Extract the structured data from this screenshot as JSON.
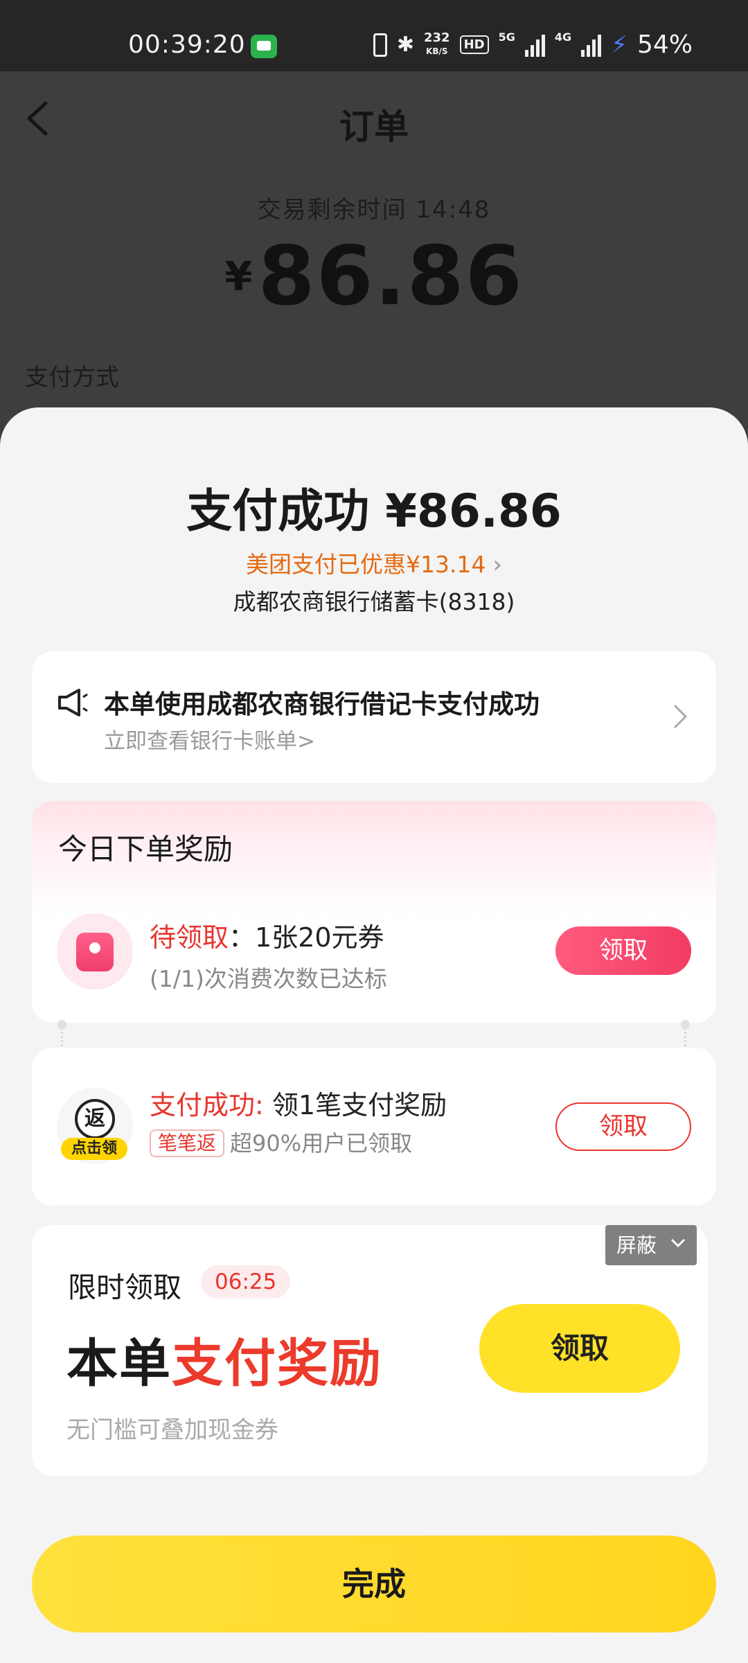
{
  "status_bar": {
    "time": "00:39:20",
    "net_speed_value": "232",
    "net_speed_unit": "KB/S",
    "hd": "HD",
    "net_5g": "5G",
    "net_4g": "4G",
    "battery": "54%"
  },
  "background_page": {
    "title": "订单",
    "timer": "交易剩余时间 14:48",
    "currency": "¥",
    "amount": "86.86",
    "pay_method_label": "支付方式"
  },
  "sheet": {
    "title": "支付成功 ¥86.86",
    "discount": "美团支付已优惠¥13.14",
    "card": "成都农商银行储蓄卡(8318)",
    "notice": {
      "title": "本单使用成都农商银行借记卡支付成功",
      "link": "立即查看银行卡账单>"
    },
    "reward_today": {
      "header": "今日下单奖励",
      "status": "待领取",
      "detail": "：1张20元券",
      "progress": "(1/1)次消费次数已达标",
      "button": "领取"
    },
    "reward_pay": {
      "icon_char": "返",
      "icon_tag": "点击领",
      "status": "支付成功:",
      "detail": " 领1笔支付奖励",
      "chip": "笔笔返",
      "note": "超90%用户已领取",
      "button": "领取"
    },
    "limited": {
      "header": "限时领取",
      "countdown": "06:25",
      "big_black": "本单",
      "big_red": "支付奖励",
      "sub": "无门槛可叠加现金券",
      "button": "领取",
      "hide_button": "屏蔽"
    },
    "done_button": "完成"
  },
  "colors": {
    "accent_red": "#e8352e",
    "discount_orange": "#e46a11",
    "yellow": "#ffe227",
    "pink_button": "#f23b63"
  }
}
